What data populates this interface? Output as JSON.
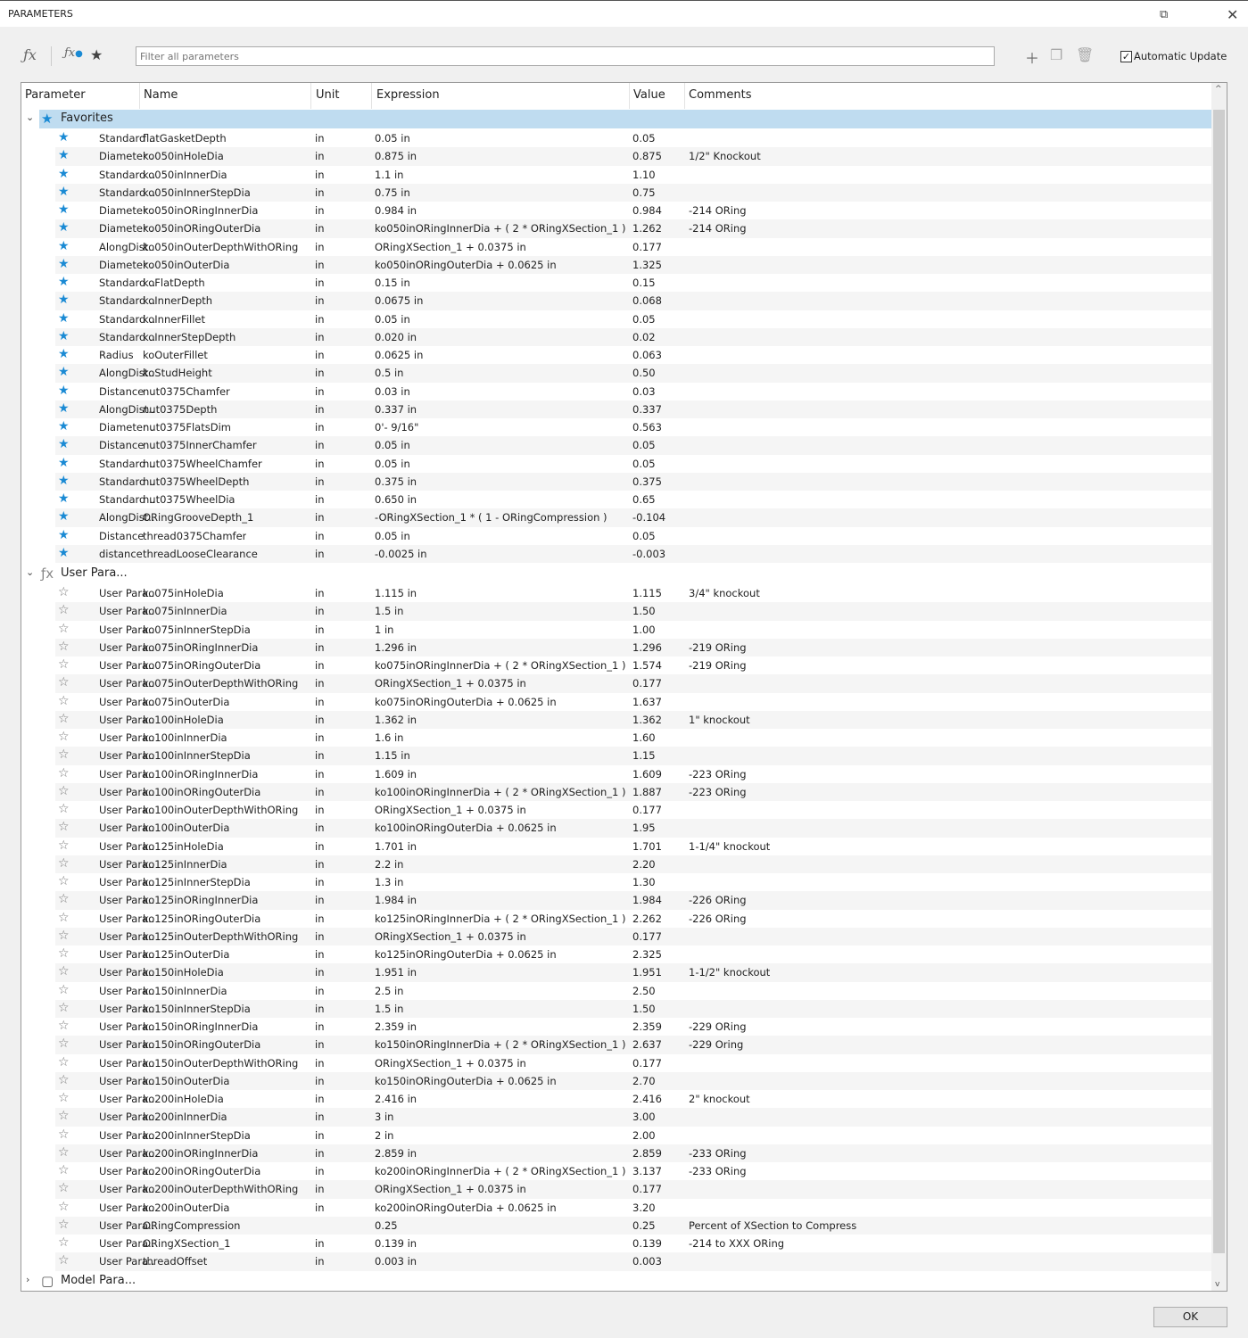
{
  "window": {
    "title": "PARAMETERS"
  },
  "toolbar": {
    "filter_placeholder": "Filter all parameters",
    "auto_update_label": "Automatic Update",
    "auto_update_checked": true
  },
  "columns": [
    "Parameter",
    "Name",
    "Unit",
    "Expression",
    "Value",
    "Comments"
  ],
  "groups": {
    "favorites": "Favorites",
    "user": "User Para...",
    "model": "Model Para..."
  },
  "favorites": [
    [
      "Standard ...",
      "flatGasketDepth",
      "in",
      "0.05 in",
      "0.05",
      ""
    ],
    [
      "Diameter ...",
      "ko050inHoleDia",
      "in",
      "0.875 in",
      "0.875",
      "1/2\" Knockout"
    ],
    [
      "Standard ...",
      "ko050inInnerDia",
      "in",
      "1.1 in",
      "1.10",
      ""
    ],
    [
      "Standard ...",
      "ko050inInnerStepDia",
      "in",
      "0.75 in",
      "0.75",
      ""
    ],
    [
      "Diameter ...",
      "ko050inORingInnerDia",
      "in",
      "0.984 in",
      "0.984",
      "-214 ORing"
    ],
    [
      "Diameter ...",
      "ko050inORingOuterDia",
      "in",
      "ko050inORingInnerDia + ( 2 * ORingXSection_1 )",
      "1.262",
      "-214 ORing"
    ],
    [
      "AlongDist...",
      "ko050inOuterDepthWithORing",
      "in",
      "ORingXSection_1 + 0.0375 in",
      "0.177",
      ""
    ],
    [
      "Diameter ...",
      "ko050inOuterDia",
      "in",
      "ko050inORingOuterDia + 0.0625 in",
      "1.325",
      ""
    ],
    [
      "Standard ...",
      "koFlatDepth",
      "in",
      "0.15 in",
      "0.15",
      ""
    ],
    [
      "Standard ...",
      "koInnerDepth",
      "in",
      "0.0675 in",
      "0.068",
      ""
    ],
    [
      "Standard ...",
      "koInnerFillet",
      "in",
      "0.05 in",
      "0.05",
      ""
    ],
    [
      "Standard ...",
      "koInnerStepDepth",
      "in",
      "0.020 in",
      "0.02",
      ""
    ],
    [
      "Radius",
      "koOuterFillet",
      "in",
      "0.0625 in",
      "0.063",
      ""
    ],
    [
      "AlongDist...",
      "koStudHeight",
      "in",
      "0.5 in",
      "0.50",
      ""
    ],
    [
      "Distance",
      "nut0375Chamfer",
      "in",
      "0.03 in",
      "0.03",
      ""
    ],
    [
      "AlongDist...",
      "nut0375Depth",
      "in",
      "0.337 in",
      "0.337",
      ""
    ],
    [
      "Diameter ...",
      "nut0375FlatsDim",
      "in",
      "0'- 9/16\"",
      "0.563",
      ""
    ],
    [
      "Distance",
      "nut0375InnerChamfer",
      "in",
      "0.05 in",
      "0.05",
      ""
    ],
    [
      "Standard ...",
      "nut0375WheelChamfer",
      "in",
      "0.05 in",
      "0.05",
      ""
    ],
    [
      "Standard ...",
      "nut0375WheelDepth",
      "in",
      "0.375 in",
      "0.375",
      ""
    ],
    [
      "Standard ...",
      "nut0375WheelDia",
      "in",
      "0.650 in",
      "0.65",
      ""
    ],
    [
      "AlongDist...",
      "ORingGrooveDepth_1",
      "in",
      "-ORingXSection_1 * ( 1 - ORingCompression )",
      "-0.104",
      ""
    ],
    [
      "Distance",
      "thread0375Chamfer",
      "in",
      "0.05 in",
      "0.05",
      ""
    ],
    [
      "distance",
      "threadLooseClearance",
      "in",
      "-0.0025 in",
      "-0.003",
      ""
    ]
  ],
  "user": [
    [
      "User Para...",
      "ko075inHoleDia",
      "in",
      "1.115 in",
      "1.115",
      "3/4\" knockout"
    ],
    [
      "User Para...",
      "ko075inInnerDia",
      "in",
      "1.5 in",
      "1.50",
      ""
    ],
    [
      "User Para...",
      "ko075inInnerStepDia",
      "in",
      "1 in",
      "1.00",
      ""
    ],
    [
      "User Para...",
      "ko075inORingInnerDia",
      "in",
      "1.296 in",
      "1.296",
      "-219 ORing"
    ],
    [
      "User Para...",
      "ko075inORingOuterDia",
      "in",
      "ko075inORingInnerDia + ( 2 * ORingXSection_1 )",
      "1.574",
      "-219 ORing"
    ],
    [
      "User Para...",
      "ko075inOuterDepthWithORing",
      "in",
      "ORingXSection_1 + 0.0375 in",
      "0.177",
      ""
    ],
    [
      "User Para...",
      "ko075inOuterDia",
      "in",
      "ko075inORingOuterDia + 0.0625 in",
      "1.637",
      ""
    ],
    [
      "User Para...",
      "ko100inHoleDia",
      "in",
      "1.362 in",
      "1.362",
      "1\" knockout"
    ],
    [
      "User Para...",
      "ko100inInnerDia",
      "in",
      "1.6 in",
      "1.60",
      ""
    ],
    [
      "User Para...",
      "ko100inInnerStepDia",
      "in",
      "1.15 in",
      "1.15",
      ""
    ],
    [
      "User Para...",
      "ko100inORingInnerDia",
      "in",
      "1.609 in",
      "1.609",
      "-223 ORing"
    ],
    [
      "User Para...",
      "ko100inORingOuterDia",
      "in",
      "ko100inORingInnerDia + ( 2 * ORingXSection_1 )",
      "1.887",
      "-223 ORing"
    ],
    [
      "User Para...",
      "ko100inOuterDepthWithORing",
      "in",
      "ORingXSection_1 + 0.0375 in",
      "0.177",
      ""
    ],
    [
      "User Para...",
      "ko100inOuterDia",
      "in",
      "ko100inORingOuterDia + 0.0625 in",
      "1.95",
      ""
    ],
    [
      "User Para...",
      "ko125inHoleDia",
      "in",
      "1.701 in",
      "1.701",
      "1-1/4\" knockout"
    ],
    [
      "User Para...",
      "ko125inInnerDia",
      "in",
      "2.2 in",
      "2.20",
      ""
    ],
    [
      "User Para...",
      "ko125inInnerStepDia",
      "in",
      "1.3 in",
      "1.30",
      ""
    ],
    [
      "User Para...",
      "ko125inORingInnerDia",
      "in",
      "1.984 in",
      "1.984",
      "-226 ORing"
    ],
    [
      "User Para...",
      "ko125inORingOuterDia",
      "in",
      "ko125inORingInnerDia + ( 2 * ORingXSection_1 )",
      "2.262",
      "-226 ORing"
    ],
    [
      "User Para...",
      "ko125inOuterDepthWithORing",
      "in",
      "ORingXSection_1 + 0.0375 in",
      "0.177",
      ""
    ],
    [
      "User Para...",
      "ko125inOuterDia",
      "in",
      "ko125inORingOuterDia + 0.0625 in",
      "2.325",
      ""
    ],
    [
      "User Para...",
      "ko150inHoleDia",
      "in",
      "1.951 in",
      "1.951",
      "1-1/2\" knockout"
    ],
    [
      "User Para...",
      "ko150inInnerDia",
      "in",
      "2.5 in",
      "2.50",
      ""
    ],
    [
      "User Para...",
      "ko150inInnerStepDia",
      "in",
      "1.5 in",
      "1.50",
      ""
    ],
    [
      "User Para...",
      "ko150inORingInnerDia",
      "in",
      "2.359 in",
      "2.359",
      "-229 ORing"
    ],
    [
      "User Para...",
      "ko150inORingOuterDia",
      "in",
      "ko150inORingInnerDia + ( 2 * ORingXSection_1 )",
      "2.637",
      "-229 Oring"
    ],
    [
      "User Para...",
      "ko150inOuterDepthWithORing",
      "in",
      "ORingXSection_1 + 0.0375 in",
      "0.177",
      ""
    ],
    [
      "User Para...",
      "ko150inOuterDia",
      "in",
      "ko150inORingOuterDia + 0.0625 in",
      "2.70",
      ""
    ],
    [
      "User Para...",
      "ko200inHoleDia",
      "in",
      "2.416 in",
      "2.416",
      "2\" knockout"
    ],
    [
      "User Para...",
      "ko200inInnerDia",
      "in",
      "3 in",
      "3.00",
      ""
    ],
    [
      "User Para...",
      "ko200inInnerStepDia",
      "in",
      "2 in",
      "2.00",
      ""
    ],
    [
      "User Para...",
      "ko200inORingInnerDia",
      "in",
      "2.859 in",
      "2.859",
      "-233 ORing"
    ],
    [
      "User Para...",
      "ko200inORingOuterDia",
      "in",
      "ko200inORingInnerDia + ( 2 * ORingXSection_1 )",
      "3.137",
      "-233 ORing"
    ],
    [
      "User Para...",
      "ko200inOuterDepthWithORing",
      "in",
      "ORingXSection_1 + 0.0375 in",
      "0.177",
      ""
    ],
    [
      "User Para...",
      "ko200inOuterDia",
      "in",
      "ko200inORingOuterDia + 0.0625 in",
      "3.20",
      ""
    ],
    [
      "User Para...",
      "ORingCompression",
      "",
      "0.25",
      "0.25",
      "Percent of XSection to Compress"
    ],
    [
      "User Para...",
      "ORingXSection_1",
      "in",
      "0.139 in",
      "0.139",
      "-214 to XXX ORing"
    ],
    [
      "User Para...",
      "threadOffset",
      "in",
      "0.003 in",
      "0.003",
      ""
    ]
  ],
  "footer": {
    "ok_label": "OK"
  },
  "colors": {
    "accent": "#1a8ad4",
    "selection": "#bfdcf0"
  }
}
